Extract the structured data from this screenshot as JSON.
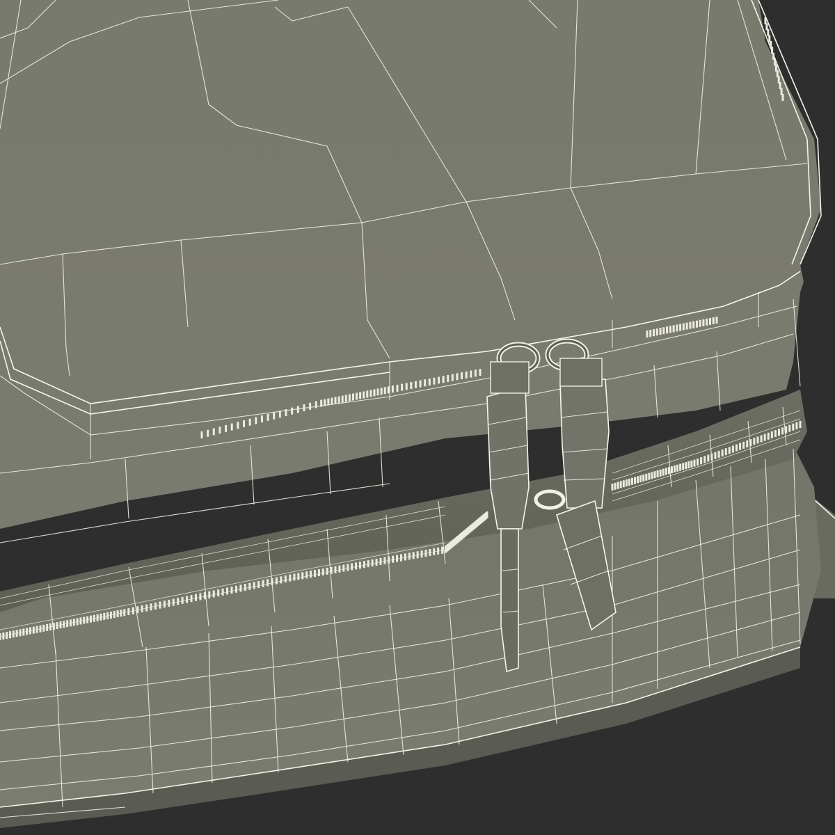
{
  "scene": {
    "subject": "wireframe-bag-render",
    "colors": {
      "background": "#2e2e2e",
      "surface": "#7c7c70",
      "surface_dark": "#63645a",
      "wire": "#f2f1e6"
    }
  }
}
